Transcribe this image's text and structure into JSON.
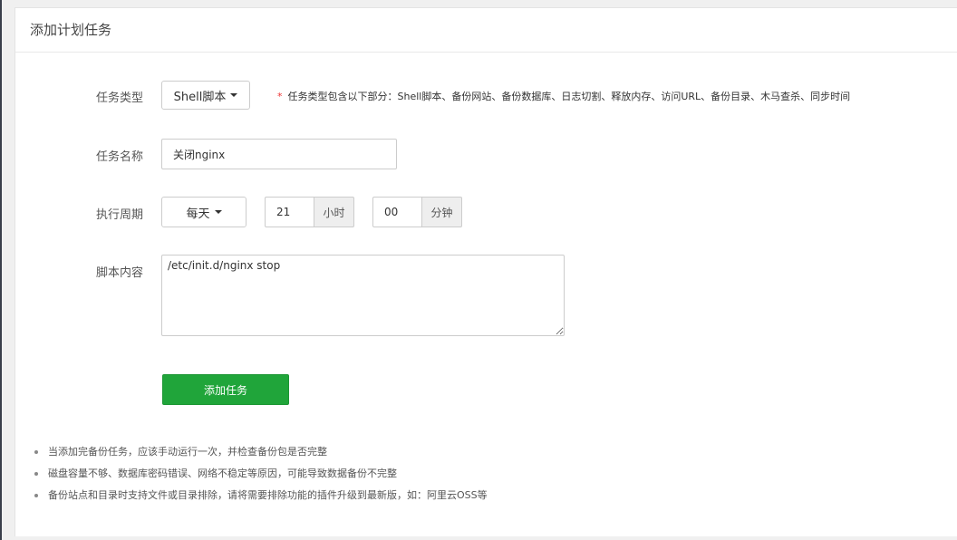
{
  "panel": {
    "title": "添加计划任务"
  },
  "form": {
    "task_type": {
      "label": "任务类型",
      "selected": "Shell脚本",
      "hint": "任务类型包含以下部分：Shell脚本、备份网站、备份数据库、日志切割、释放内存、访问URL、备份目录、木马查杀、同步时间",
      "hint_star": "*"
    },
    "task_name": {
      "label": "任务名称",
      "value": "关闭nginx"
    },
    "schedule": {
      "label": "执行周期",
      "period": "每天",
      "hour_value": "21",
      "hour_unit": "小时",
      "minute_value": "00",
      "minute_unit": "分钟"
    },
    "script": {
      "label": "脚本内容",
      "value": "/etc/init.d/nginx stop"
    },
    "submit_label": "添加任务"
  },
  "notes": [
    "当添加完备份任务，应该手动运行一次，并检查备份包是否完整",
    "磁盘容量不够、数据库密码错误、网络不稳定等原因，可能导致数据备份不完整",
    "备份站点和目录时支持文件或目录排除，请将需要排除功能的插件升级到最新版，如：阿里云OSS等"
  ],
  "colors": {
    "accent": "#20a53a",
    "required_star": "#ee3333",
    "sidebar_edge": "#3a3f4b"
  }
}
